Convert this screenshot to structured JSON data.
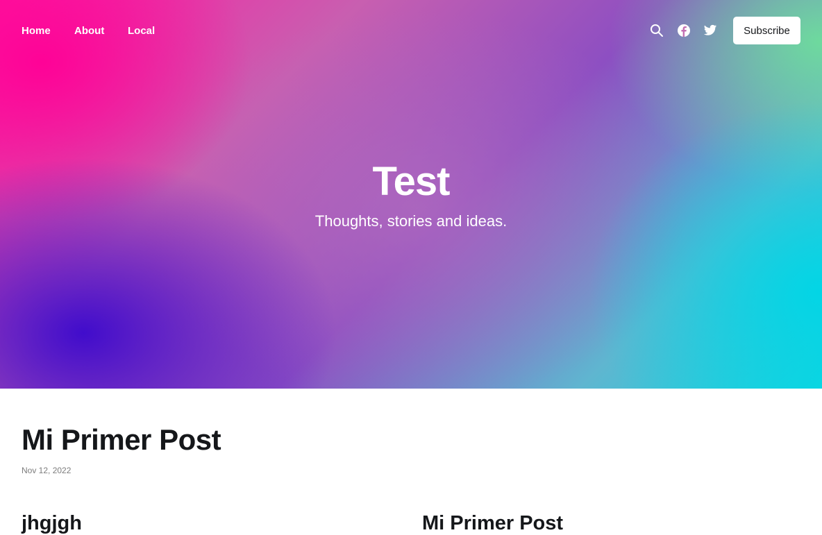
{
  "nav": {
    "links": [
      "Home",
      "About",
      "Local"
    ],
    "subscribe_label": "Subscribe",
    "icons": [
      "search-icon",
      "facebook-icon",
      "twitter-icon"
    ]
  },
  "hero": {
    "title": "Test",
    "description": "Thoughts, stories and ideas."
  },
  "feed": {
    "featured": {
      "title": "Mi Primer Post",
      "date": "Nov 12, 2022"
    },
    "cards": [
      {
        "title": "jhgjgh"
      },
      {
        "title": "Mi Primer Post"
      }
    ]
  },
  "colors": {
    "accent_pink": "#ff1aa0",
    "accent_cyan": "#10d6e0",
    "accent_purple": "#3a08cd",
    "text_dark": "#15171a",
    "meta_gray": "#7c7c7c"
  }
}
